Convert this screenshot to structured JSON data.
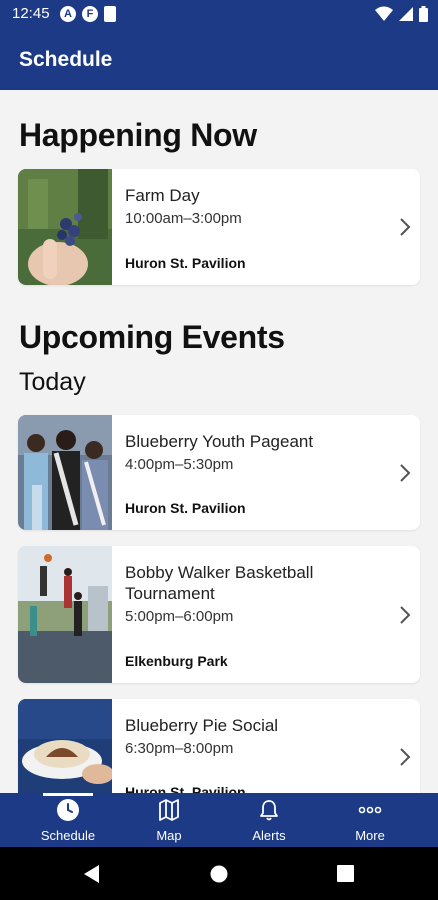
{
  "status_bar": {
    "time": "12:45",
    "icons": [
      "a-badge-icon",
      "f-badge-icon",
      "sd-card-icon",
      "wifi-icon",
      "signal-icon",
      "battery-icon"
    ],
    "badge_a": "A",
    "badge_f": "F"
  },
  "header": {
    "title": "Schedule"
  },
  "happening_now": {
    "heading": "Happening Now",
    "events": [
      {
        "title": "Farm Day",
        "time": "10:00am–3:00pm",
        "location": "Huron St. Pavilion"
      }
    ]
  },
  "upcoming": {
    "heading": "Upcoming Events",
    "day_label": "Today",
    "events": [
      {
        "title": "Blueberry Youth Pageant",
        "time": "4:00pm–5:30pm",
        "location": "Huron St. Pavilion"
      },
      {
        "title": "Bobby Walker Basketball Tournament",
        "time": "5:00pm–6:00pm",
        "location": "Elkenburg Park"
      },
      {
        "title": "Blueberry Pie Social",
        "time": "6:30pm–8:00pm",
        "location": "Huron St. Pavilion"
      }
    ]
  },
  "bottom_nav": {
    "active": "Schedule",
    "items": [
      {
        "label": "Schedule",
        "icon": "clock-icon"
      },
      {
        "label": "Map",
        "icon": "map-icon"
      },
      {
        "label": "Alerts",
        "icon": "bell-icon"
      },
      {
        "label": "More",
        "icon": "more-dots-icon"
      }
    ]
  },
  "system_nav": {
    "icons": [
      "back-icon",
      "home-icon",
      "recents-icon"
    ]
  },
  "colors": {
    "brand_blue": "#1c3a86",
    "background": "#f3f3f3",
    "card": "#ffffff"
  }
}
